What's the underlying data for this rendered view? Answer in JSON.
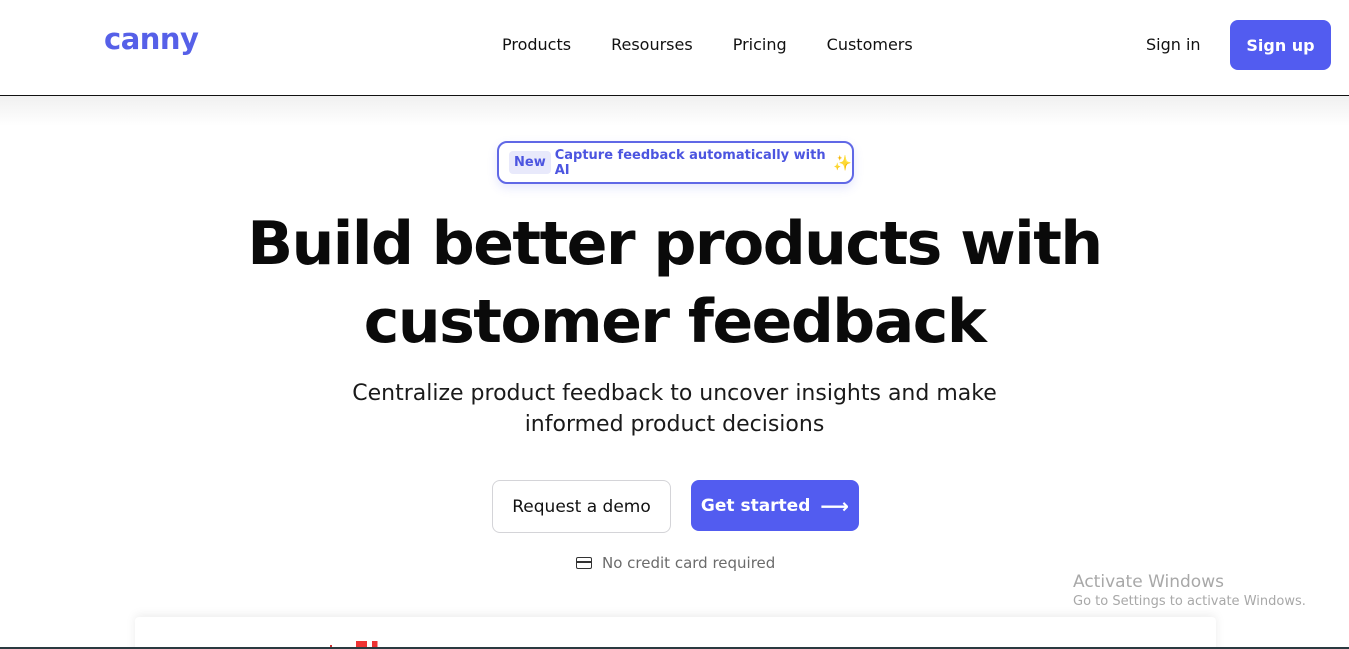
{
  "header": {
    "logo": "canny",
    "nav": [
      "Products",
      "Resourses",
      "Pricing",
      "Customers"
    ],
    "signin_label": "Sign in",
    "signup_label": "Sign up"
  },
  "announcement": {
    "badge": "New",
    "text": "Capture feedback automatically with AI",
    "icon": "sparkle-icon"
  },
  "hero": {
    "title_line1": "Build better products with",
    "title_line2": "customer feedback",
    "subtitle_line1": "Centralize product feedback to uncover insights and make",
    "subtitle_line2": "informed product decisions",
    "demo_label": "Request a demo",
    "start_label": "Get started",
    "start_icon": "arrow-right-icon",
    "note": "No credit card required",
    "note_icon": "credit-card-icon"
  },
  "watermark": {
    "title": "Activate Windows",
    "subtitle": "Go to Settings to activate Windows."
  },
  "colors": {
    "brand": "#525cf0",
    "text": "#0a0a0a"
  }
}
